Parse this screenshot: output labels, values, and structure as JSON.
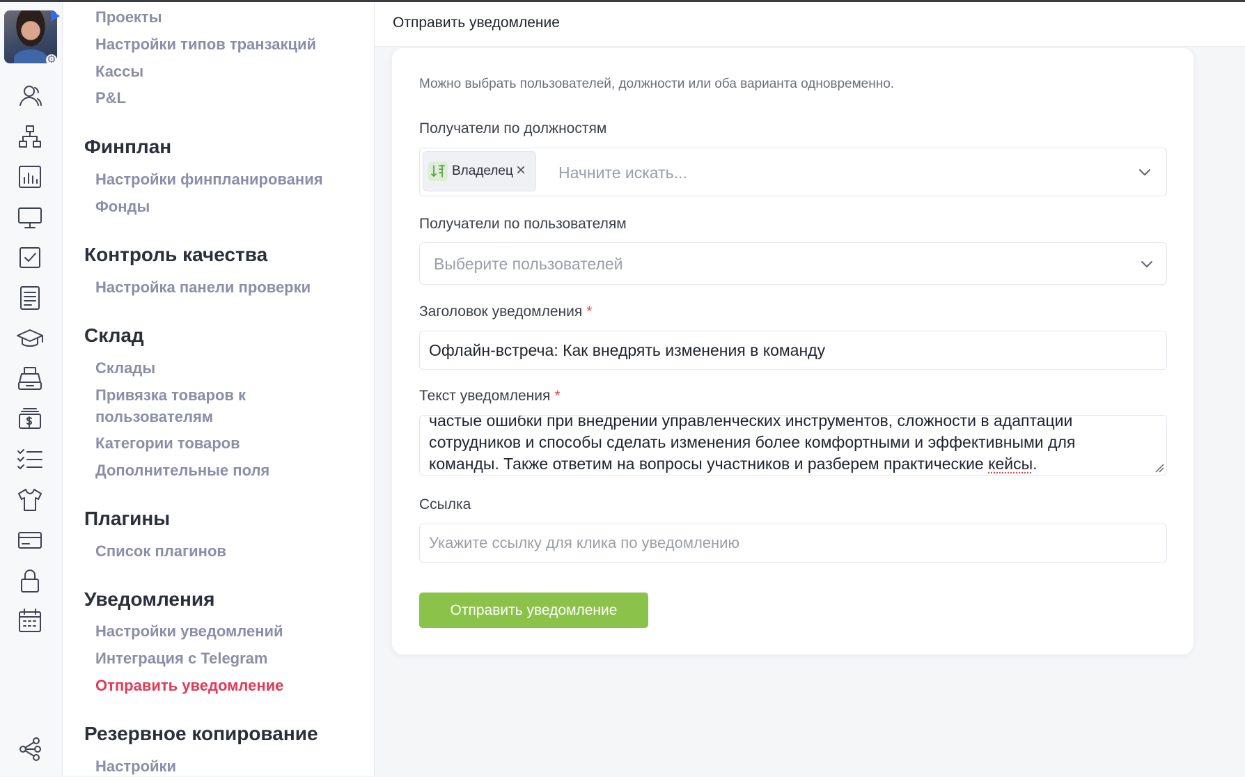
{
  "rail": {
    "icons": [
      "users-icon",
      "org-chart-icon",
      "chart-icon",
      "monitor-icon",
      "checkbox-icon",
      "document-icon",
      "graduation-cap-icon",
      "cash-register-icon",
      "money-icon",
      "checklist-icon",
      "tshirt-icon",
      "credit-card-icon",
      "lock-icon",
      "calendar-icon",
      "nodes-icon"
    ]
  },
  "nav": {
    "top_items": [
      "Проекты",
      "Настройки типов транзакций",
      "Кассы",
      "P&L"
    ],
    "sections": [
      {
        "title": "Финплан",
        "items": [
          "Настройки финпланирования",
          "Фонды"
        ]
      },
      {
        "title": "Контроль качества",
        "items": [
          "Настройка панели проверки"
        ]
      },
      {
        "title": "Склад",
        "items": [
          "Склады",
          "Привязка товаров к пользователям",
          "Категории товаров",
          "Дополнительные поля"
        ]
      },
      {
        "title": "Плагины",
        "items": [
          "Список плагинов"
        ]
      },
      {
        "title": "Уведомления",
        "items": [
          "Настройки уведомлений",
          "Интеграция с Telegram",
          "Отправить уведомление"
        ]
      },
      {
        "title": "Резервное копирование",
        "items": [
          "Настройки"
        ]
      }
    ],
    "active_item": "Отправить уведомление"
  },
  "page": {
    "title": "Отправить уведомление"
  },
  "form": {
    "hint": "Можно выбрать пользователей, должности или оба варианта одновременно.",
    "positions": {
      "label": "Получатели по должностям",
      "chip_label": "Владелец",
      "placeholder": "Начните искать..."
    },
    "users": {
      "label": "Получатели по пользователям",
      "placeholder": "Выберите пользователей"
    },
    "title_field": {
      "label": "Заголовок уведомления",
      "required_mark": "*",
      "value": "Офлайн-встреча: Как внедрять изменения в команду"
    },
    "text_field": {
      "label": "Текст уведомления",
      "required_mark": "*",
      "line1": "частые ошибки при внедрении управленческих инструментов, сложности в адаптации",
      "line2": "сотрудников и способы сделать изменения более комфортными и эффективными для",
      "line3_before": "команды. Также ответим на вопросы участников и разберем практические ",
      "line3_spell": "кейсы",
      "line3_after": "."
    },
    "link_field": {
      "label": "Ссылка",
      "placeholder": "Укажите ссылку для клика по уведомлению"
    },
    "submit_label": "Отправить уведомление"
  },
  "colors": {
    "accent_active": "#e23a58",
    "submit_button": "#8bc34a",
    "required": "#e14a4a"
  }
}
